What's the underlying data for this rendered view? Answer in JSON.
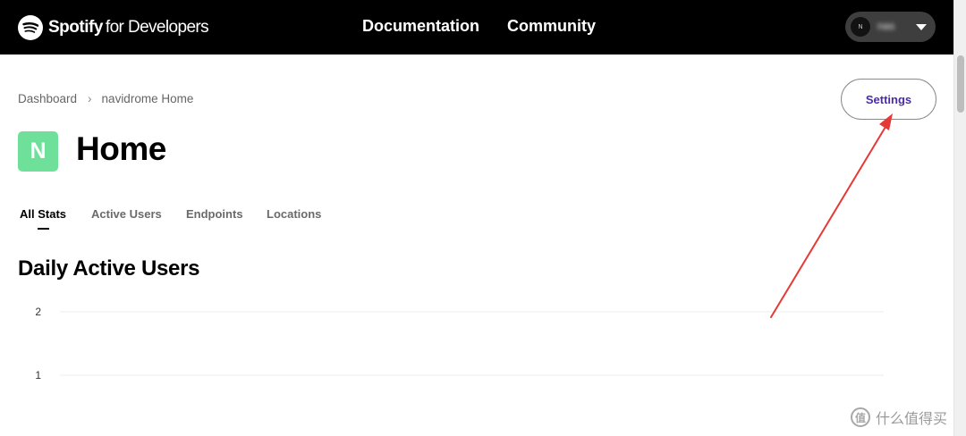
{
  "topnav": {
    "brand": "Spotify",
    "brand_suffix": "for Developers",
    "links": [
      {
        "label": "Documentation"
      },
      {
        "label": "Community"
      }
    ],
    "user": {
      "avatar_initial": "N",
      "name": "nas"
    }
  },
  "breadcrumb": {
    "items": [
      "Dashboard",
      "navidrome Home"
    ],
    "separator": "›"
  },
  "settings_label": "Settings",
  "app": {
    "icon_letter": "N",
    "icon_color": "#6fe09a",
    "title": "Home"
  },
  "tabs": [
    {
      "label": "All Stats",
      "active": true
    },
    {
      "label": "Active Users",
      "active": false
    },
    {
      "label": "Endpoints",
      "active": false
    },
    {
      "label": "Locations",
      "active": false
    }
  ],
  "section_title": "Daily Active Users",
  "chart_data": {
    "type": "line",
    "title": "Daily Active Users",
    "xlabel": "",
    "ylabel": "",
    "y_ticks": [
      2,
      1
    ],
    "grid": true,
    "series": []
  },
  "annotation": {
    "color": "#e53935",
    "target": "settings-button"
  },
  "watermark": {
    "icon": "值",
    "text": "什么值得买"
  }
}
